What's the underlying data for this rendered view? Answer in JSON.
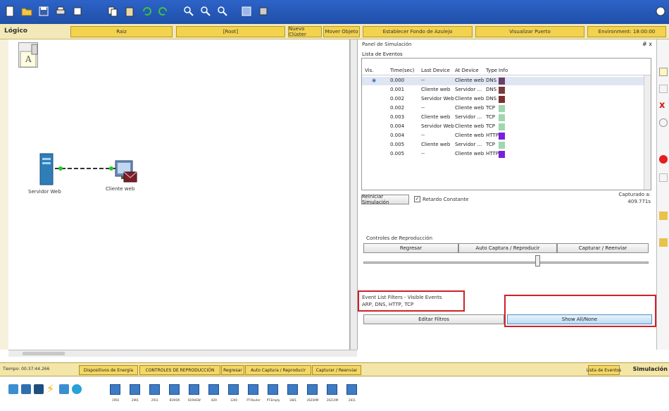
{
  "app": {
    "accent": "#1f4fa8",
    "toolbar_color": "#f3d24e"
  },
  "workspace_bar": {
    "mode": "Lógico",
    "items": [
      "Raiz",
      "[Root]",
      "Nuevo Clúster",
      "Mover Objeto",
      "Establecer Fondo de Azulejo",
      "Visualizar Puerto",
      "Environment: 18:00:00"
    ]
  },
  "topology": {
    "devices": [
      {
        "label": "Servidor Web",
        "icon": "server-icon"
      },
      {
        "label": "Cliente web",
        "icon": "pc-icon"
      }
    ]
  },
  "simulation_panel": {
    "title": "Panel de Simulación",
    "close_label": "# x",
    "event_list_title": "Lista de Eventos",
    "columns": [
      "Vis.",
      "Time(sec)",
      "Last Device",
      "At Device",
      "Type",
      "Info"
    ],
    "events": [
      {
        "time": "0.000",
        "last": "--",
        "at": "Cliente web",
        "type": "DNS",
        "color": "#6b3f6e"
      },
      {
        "time": "0.001",
        "last": "Cliente web",
        "at": "Servidor ...",
        "type": "DNS",
        "color": "#7a3b3b"
      },
      {
        "time": "0.002",
        "last": "Servidor Web",
        "at": "Cliente web",
        "type": "DNS",
        "color": "#7a3030"
      },
      {
        "time": "0.002",
        "last": "--",
        "at": "Cliente web",
        "type": "TCP",
        "color": "#9ed7b0"
      },
      {
        "time": "0.003",
        "last": "Cliente web",
        "at": "Servidor ...",
        "type": "TCP",
        "color": "#9ed7b0"
      },
      {
        "time": "0.004",
        "last": "Servidor Web",
        "at": "Cliente web",
        "type": "TCP",
        "color": "#9ed7b0"
      },
      {
        "time": "0.004",
        "last": "--",
        "at": "Cliente web",
        "type": "HTTP",
        "color": "#7a1fe0"
      },
      {
        "time": "0.005",
        "last": "Cliente web",
        "at": "Servidor ...",
        "type": "TCP",
        "color": "#9ed7b0"
      },
      {
        "time": "0.005",
        "last": "--",
        "at": "Cliente web",
        "type": "HTTP",
        "color": "#7a1fe0"
      }
    ],
    "reset_button": "Reiniciar Simulación",
    "constant_delay_label": "Retardo Constante",
    "captured_label": "Capturado a:",
    "captured_value": "409.771s",
    "playback_title": "Controles de Reproducción",
    "back_button": "Regresar",
    "auto_capture_button": "Auto Captura / Reproducir",
    "capture_forward_button": "Capturar / Reenviar",
    "filters_title": "Event List Filters - Visible Events",
    "filters_value": "ARP, DNS, HTTP, TCP",
    "edit_filters_button": "Editar Filtros",
    "show_all_button": "Show All/None"
  },
  "bottom_bar": {
    "time_label": "Tiempo: 00:37:44.266",
    "items": [
      "Dispositivos de Energía",
      "CONTROLES DE REPRODUCCIÓN",
      "Regresar",
      "Auto Captura / Reproducir",
      "Capturar / Reenviar"
    ],
    "event_list_button": "Lista de Eventos",
    "mode_label": "Simulación"
  },
  "device_bar": {
    "switch_labels": [
      "1950",
      "2901",
      "2911",
      "819IOX",
      "819HGW",
      "829",
      "1240",
      "PT-Router",
      "PT-Empty",
      "1841",
      "2620XM",
      "2621XM",
      "2811"
    ]
  }
}
